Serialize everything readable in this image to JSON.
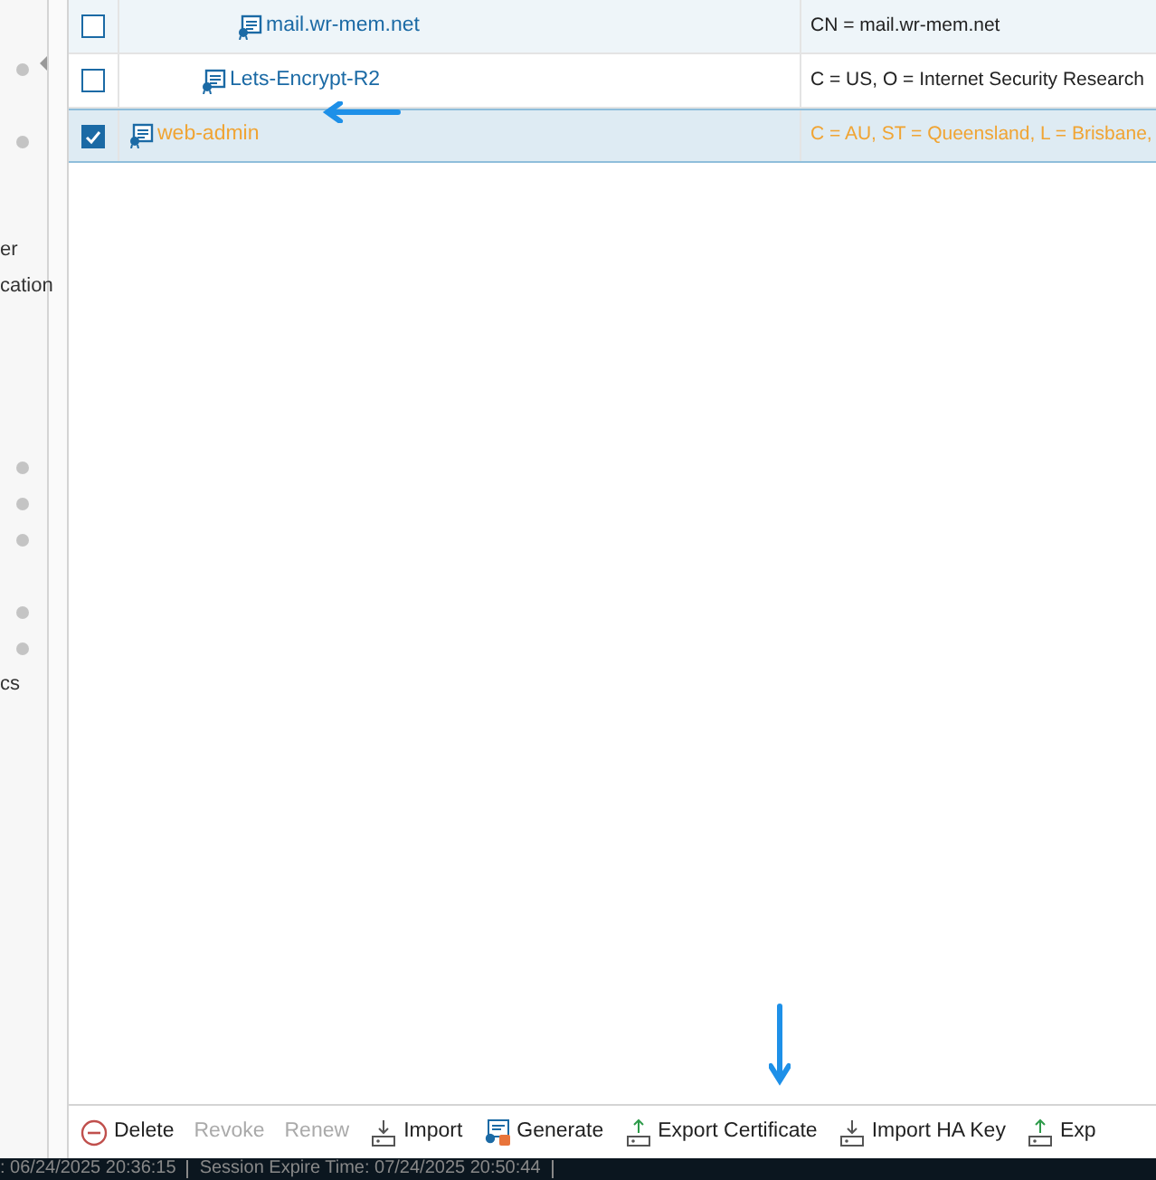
{
  "sidebar": {
    "items": [
      {
        "kind": "dot"
      },
      {
        "kind": "blank"
      },
      {
        "kind": "dot"
      },
      {
        "kind": "blank"
      },
      {
        "kind": "blank"
      },
      {
        "kind": "text",
        "label": "er"
      },
      {
        "kind": "text",
        "label": "cation"
      },
      {
        "kind": "blank"
      },
      {
        "kind": "blank"
      },
      {
        "kind": "blank"
      },
      {
        "kind": "blank"
      },
      {
        "kind": "dot"
      },
      {
        "kind": "dot"
      },
      {
        "kind": "dot"
      },
      {
        "kind": "blank"
      },
      {
        "kind": "dot"
      },
      {
        "kind": "dot"
      },
      {
        "kind": "text",
        "label": "cs"
      }
    ]
  },
  "table": {
    "rows": [
      {
        "children": [
          {
            "children": [
              {
                "children": [
                  {
                    "name": "mail.wr-mem.net",
                    "subject": "CN = mail.wr-mem.net",
                    "checked": false,
                    "selected": false
                  }
                ]
              },
              {
                "name": "Lets-Encrypt-R2",
                "subject": "C = US, O = Internet Security Research",
                "checked": false,
                "selected": false
              }
            ]
          }
        ]
      },
      {
        "name": "web-admin",
        "subject": "C = AU, ST = Queensland, L = Brisbane,",
        "checked": true,
        "selected": true
      }
    ]
  },
  "toolbar": {
    "buttons": [
      {
        "label": "Delete",
        "kind": "delete",
        "disabled": false
      },
      {
        "label": "Revoke",
        "kind": "plain",
        "disabled": true
      },
      {
        "label": "Renew",
        "kind": "plain",
        "disabled": true
      },
      {
        "label": "Import",
        "kind": "import",
        "disabled": false
      },
      {
        "label": "Generate",
        "kind": "generate",
        "disabled": false
      },
      {
        "label": "Export Certificate",
        "kind": "export",
        "disabled": false
      },
      {
        "label": "Import HA Key",
        "kind": "import",
        "disabled": false
      },
      {
        "label": "Exp",
        "kind": "export",
        "disabled": false
      }
    ]
  },
  "status_bar": {
    "items": [
      ": 06/24/2025 20:36:15",
      "Session Expire Time: 07/24/2025 20:50:44"
    ]
  }
}
